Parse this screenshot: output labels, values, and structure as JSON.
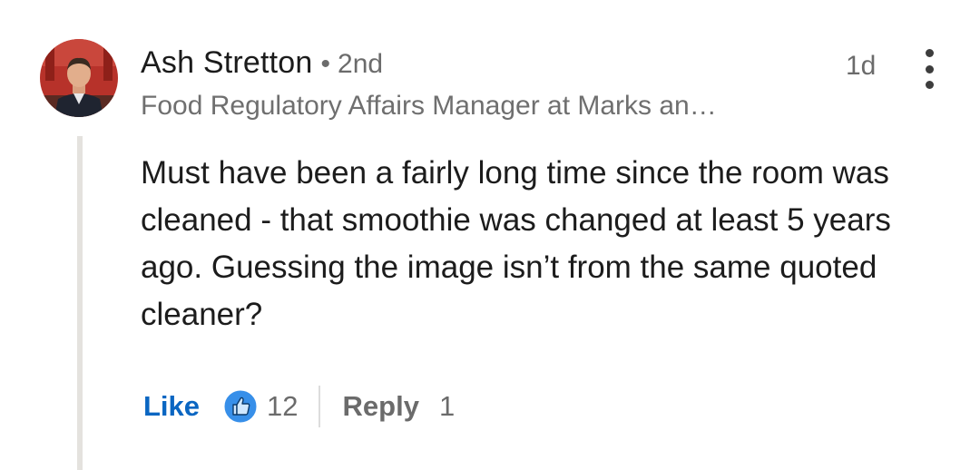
{
  "comment": {
    "author": {
      "name": "Ash Stretton",
      "separator": "•",
      "degree": "2nd",
      "headline": "Food Regulatory Affairs Manager at Marks an…"
    },
    "timestamp": "1d",
    "more_icon": "vertical-ellipsis-icon",
    "text": "Must have been a fairly long time since the room was cleaned - that smoothie was changed at least 5 years ago. Guessing the image isn’t from the same quoted cleaner?",
    "actions": {
      "like_label": "Like",
      "like_icon": "thumbs-up-icon",
      "like_count": "12",
      "reply_label": "Reply",
      "reply_count": "1"
    },
    "colors": {
      "link_blue": "#0a66c2",
      "secondary_text": "#6b6b6b",
      "thread_line": "#e4e2de"
    }
  }
}
